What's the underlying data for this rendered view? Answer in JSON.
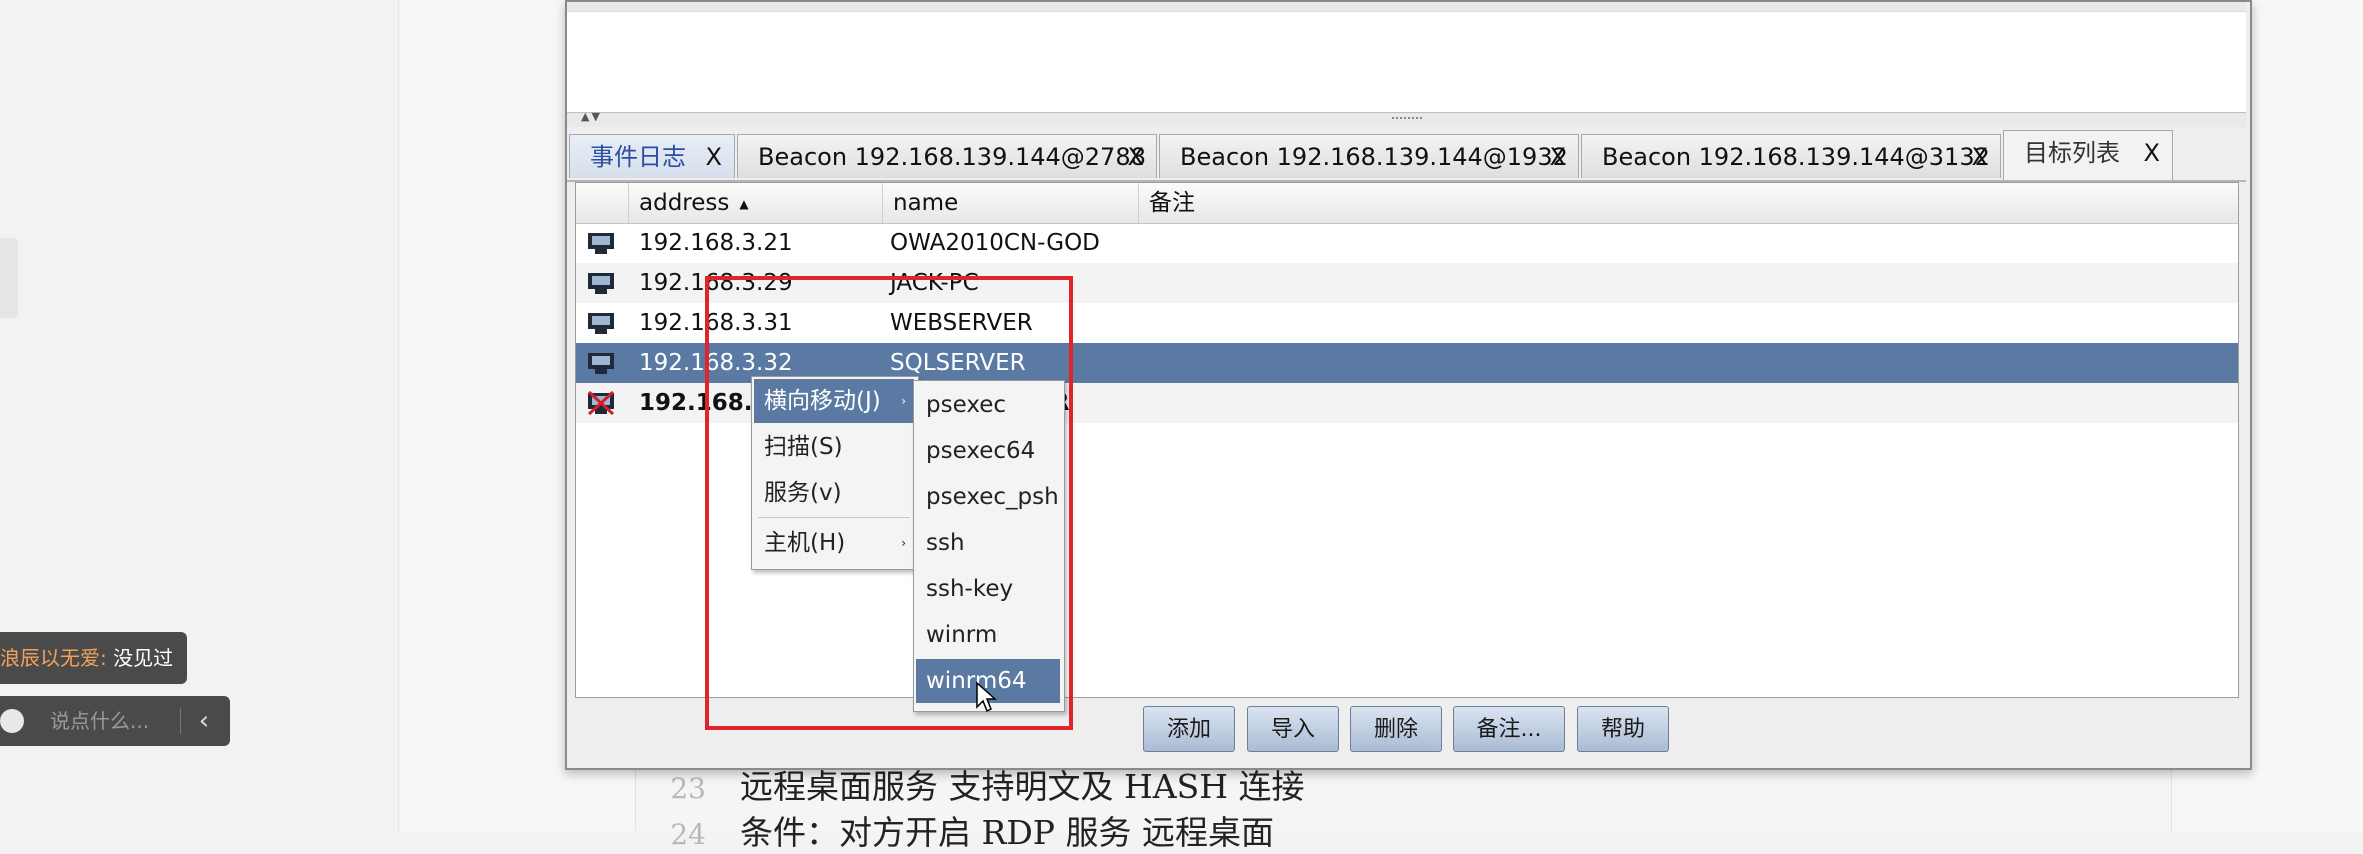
{
  "overlay": {
    "danmaku_user": "浪辰以无爱:",
    "danmaku_text": "没见过",
    "chat_placeholder": "说点什么...",
    "chat_send_icon": "chevron-left-icon"
  },
  "document": {
    "lines": [
      {
        "num": "23",
        "text": "远程桌面服务 支持明文及 HASH 连接"
      },
      {
        "num": "24",
        "text": "条件：对方开启 RDP 服务 远程桌面"
      }
    ]
  },
  "tabs": [
    {
      "label": "事件日志",
      "close": "X"
    },
    {
      "label": "Beacon 192.168.139.144@2788",
      "close": "X"
    },
    {
      "label": "Beacon 192.168.139.144@1932",
      "close": "X"
    },
    {
      "label": "Beacon 192.168.139.144@3132",
      "close": "X"
    },
    {
      "label": "目标列表",
      "close": "X"
    }
  ],
  "table": {
    "headers": {
      "address": "address",
      "sort_icon": "▲",
      "name": "name",
      "note": "备注"
    },
    "rows": [
      {
        "address": "192.168.3.21",
        "name": "OWA2010CN-GOD"
      },
      {
        "address": "192.168.3.29",
        "name": "JACK-PC"
      },
      {
        "address": "192.168.3.31",
        "name": "WEBSERVER"
      },
      {
        "address": "192.168.3.32",
        "name": "SQLSERVER"
      },
      {
        "address": "192.168.1",
        "name": "ER"
      }
    ]
  },
  "context_menu": {
    "items": [
      {
        "label": "横向移动(J)",
        "has_sub": "›"
      },
      {
        "label": "扫描(S)"
      },
      {
        "label": "服务(v)"
      },
      {
        "label": "主机(H)",
        "has_sub": "›"
      }
    ]
  },
  "submenu": {
    "items": [
      "psexec",
      "psexec64",
      "psexec_psh",
      "ssh",
      "ssh-key",
      "winrm",
      "winrm64"
    ]
  },
  "buttons": {
    "add": "添加",
    "import": "导入",
    "delete": "删除",
    "note": "备注...",
    "help": "帮助"
  },
  "colors": {
    "selection": "#5b7aa3",
    "annotation_box": "#e0242a"
  }
}
